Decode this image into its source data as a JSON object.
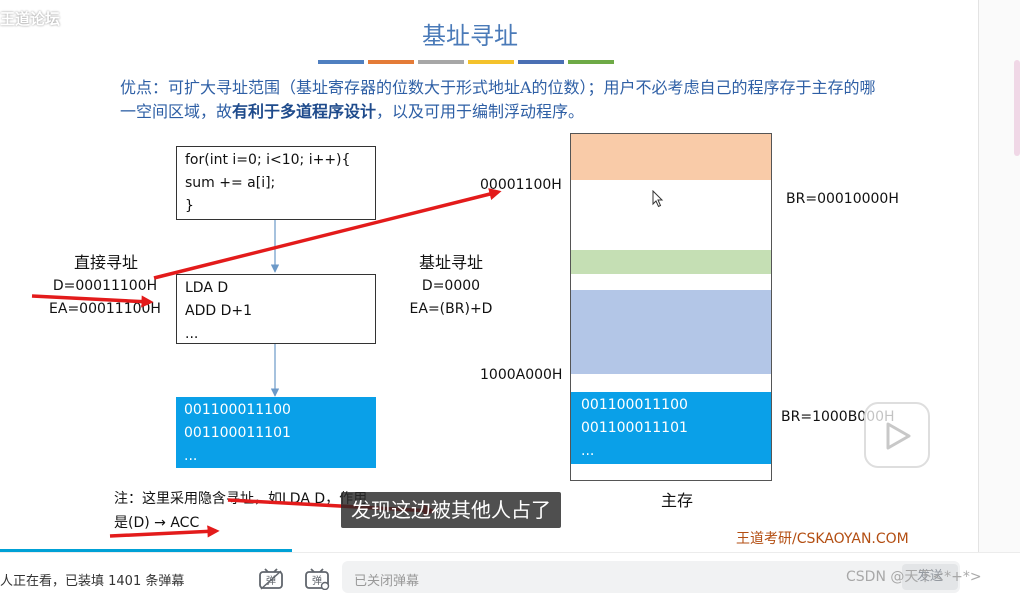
{
  "watermark": "王道论坛",
  "slide": {
    "title": "基址寻址",
    "color_bars": [
      "#4f7fc0",
      "#e47b37",
      "#a7a7a7",
      "#f4c22b",
      "#4a6fb4",
      "#6eaa46"
    ],
    "desc_prefix": "优点：可扩大寻址范围（基址寄存器的位数大于形式地址A的位数）；用户不必考虑自己的程序存于主存的哪一空间区域，故",
    "desc_bold": "有利于多道程序设计",
    "desc_suffix": "，以及可用于编制浮动程序。",
    "code_box": [
      "for(int i=0; i<10; i++){",
      "sum += a[i];",
      "}"
    ],
    "instr_box": [
      "LDA D",
      "ADD D+1",
      "..."
    ],
    "data_box": [
      "001100011100",
      "001100011101",
      "..."
    ],
    "direct": {
      "title": "直接寻址",
      "d": "D=00011100H",
      "ea": "EA=00011100H"
    },
    "base": {
      "title": "基址寻址",
      "d": "D=0000",
      "ea": "EA=(BR)+D"
    },
    "addr_top": "00001100H",
    "addr_bottom": "1000A000H",
    "br_top": "BR=00010000H",
    "br_bottom": "BR=1000B000H",
    "memory_label": "主存",
    "memory_data": [
      "001100011100",
      "001100011101",
      "..."
    ],
    "mem_colors": {
      "orange": "#f9cba8",
      "green": "#c5dfb4",
      "blue_light": "#b3c6e7",
      "blue": "#0aa0e8"
    },
    "note_line1": "注：这里采用隐含寻址，如LDA D，作用",
    "note_line2": "是(D) → ACC",
    "brand": "王道考研/CSKAOYAN.COM"
  },
  "overlay": {
    "subtitle": "发现这边被其他人占了"
  },
  "player": {
    "viewers": "人正在看，已装填 1401 条弹幕",
    "danmaku_placeholder": "已关闭弹幕",
    "send": "发送",
    "csdn": "CSDN @天下<*+*>"
  }
}
